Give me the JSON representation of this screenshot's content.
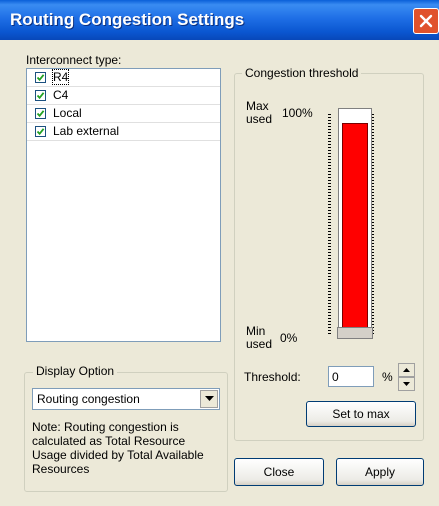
{
  "window": {
    "title": "Routing Congestion Settings",
    "close_icon": "close-icon"
  },
  "interconnect": {
    "label": "Interconnect type:",
    "items": [
      {
        "label": "R4",
        "checked": true
      },
      {
        "label": "C4",
        "checked": true
      },
      {
        "label": "Local",
        "checked": true
      },
      {
        "label": "Lab external",
        "checked": true
      }
    ]
  },
  "display_option": {
    "legend": "Display Option",
    "selected": "Routing congestion",
    "note": "Note: Routing congestion is calculated as Total Resource Usage divided by Total Available Resources"
  },
  "threshold_group": {
    "legend": "Congestion threshold",
    "max_label": "Max used",
    "max_value": "100%",
    "min_label": "Min used",
    "min_value": "0%",
    "fill_fraction": 0.95,
    "fill_color": "#ff0000",
    "threshold_label": "Threshold:",
    "threshold_value": "0",
    "unit": "%",
    "set_to_max": "Set to max"
  },
  "buttons": {
    "close": "Close",
    "apply": "Apply"
  }
}
